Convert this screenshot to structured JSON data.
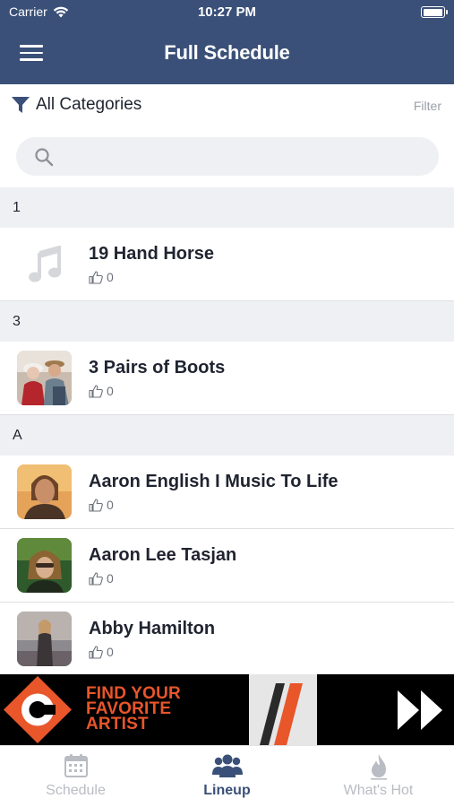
{
  "status_bar": {
    "carrier": "Carrier",
    "time": "10:27 PM",
    "battery_level": 1.0
  },
  "nav": {
    "title": "Full Schedule"
  },
  "filter": {
    "category_label": "All Categories",
    "filter_link": "Filter"
  },
  "search": {
    "placeholder": "",
    "value": ""
  },
  "sections": [
    {
      "header": "1",
      "items": [
        {
          "name": "19 Hand Horse",
          "likes": "0",
          "thumb": "music-note"
        }
      ]
    },
    {
      "header": "3",
      "items": [
        {
          "name": "3 Pairs of Boots",
          "likes": "0",
          "thumb": "photo"
        }
      ]
    },
    {
      "header": "A",
      "items": [
        {
          "name": "Aaron English I Music To Life",
          "likes": "0",
          "thumb": "photo"
        },
        {
          "name": "Aaron Lee Tasjan",
          "likes": "0",
          "thumb": "photo"
        },
        {
          "name": "Abby Hamilton",
          "likes": "0",
          "thumb": "photo"
        }
      ]
    }
  ],
  "banner": {
    "line1": "FIND YOUR",
    "line2": "FAVORITE",
    "line3": "ARTIST",
    "logo_letter": "C"
  },
  "tabs": [
    {
      "label": "Schedule",
      "icon": "calendar-icon",
      "active": false
    },
    {
      "label": "Lineup",
      "icon": "people-icon",
      "active": true
    },
    {
      "label": "What's Hot",
      "icon": "flame-icon",
      "active": false
    }
  ],
  "colors": {
    "nav_bg": "#3a5078",
    "accent": "#3a5078",
    "banner_orange": "#e8562a",
    "section_bg": "#eff0f3"
  }
}
